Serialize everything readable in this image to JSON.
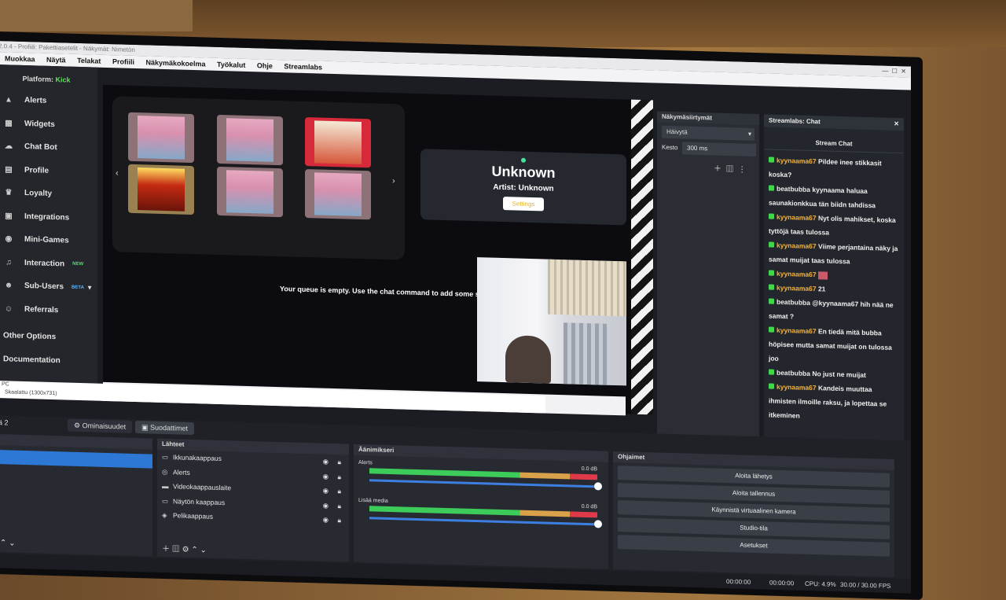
{
  "window": {
    "title": "2.0.4 - Profiili: Pakettiasetelit - Näkymät: Nimetön"
  },
  "menu": [
    "Muokkaa",
    "Näytä",
    "Telakat",
    "Profiili",
    "Näkymäkokoelma",
    "Työkalut",
    "Ohje",
    "Streamlabs"
  ],
  "sidebar": {
    "platform_label": "Platform:",
    "platform_value": "Kick",
    "items": [
      {
        "label": "Alerts",
        "icon": "alert-icon"
      },
      {
        "label": "Widgets",
        "icon": "widgets-icon"
      },
      {
        "label": "Chat Bot",
        "icon": "cloud-icon"
      },
      {
        "label": "Profile",
        "icon": "profile-icon"
      },
      {
        "label": "Loyalty",
        "icon": "trophy-icon"
      },
      {
        "label": "Integrations",
        "icon": "integrations-icon"
      },
      {
        "label": "Mini-Games",
        "icon": "gamepad-icon"
      },
      {
        "label": "Interaction",
        "icon": "music-icon",
        "badge": "NEW"
      },
      {
        "label": "Sub-Users",
        "icon": "users-icon",
        "badge": "BETA"
      },
      {
        "label": "Referrals",
        "icon": "referrals-icon"
      }
    ],
    "other_options": "Other Options",
    "documentation": "Documentation"
  },
  "preview": {
    "song_title": "Unknown",
    "artist_label": "Artist:",
    "artist_value": "Unknown",
    "settings_button": "Settings",
    "queue_message": "Your queue is empty. Use the chat command to add some song",
    "status_left": "PC",
    "scale_label": "Skaalattu (1300x731)"
  },
  "scene_transitions": {
    "title": "Näkymäsiirtymät",
    "transition": "Häivytä",
    "duration_label": "Kesto",
    "duration_value": "300 ms"
  },
  "chat": {
    "title": "Streamlabs: Chat",
    "subtitle": "Stream Chat",
    "messages": [
      {
        "user": "kyynaama67",
        "text": "Pildee inee stikkasit koska?"
      },
      {
        "user": "beatbubba",
        "text": "kyynaama haluaa saunakionkkua tän biidn tahdissa"
      },
      {
        "user": "kyynaama67",
        "text": "Nyt olis mahikset, koska tyttöjä taas tulossa"
      },
      {
        "user": "kyynaama67",
        "text": "Viime perjantaina näky ja samat muijat taas tulossa"
      },
      {
        "user": "kyynaama67",
        "text": ""
      },
      {
        "user": "kyynaama67",
        "text": "21"
      },
      {
        "user": "beatbubba",
        "text": "@kyynaama67 hih nää ne samat ?"
      },
      {
        "user": "kyynaama67",
        "text": "En tiedä mitä bubba höpisee mutta samat muijat on tulossa joo"
      },
      {
        "user": "beatbubba",
        "text": "No just ne muijat"
      },
      {
        "user": "kyynaama67",
        "text": "Kandeis muuttaa ihmisten ilmoille raksu, ja lopettaa se itkeminen"
      }
    ]
  },
  "bottom": {
    "scene_label": "ä 2",
    "tab_properties": "Ominaisuudet",
    "tab_filters": "Suodattimet",
    "sources_title": "Lähteet",
    "sources": [
      {
        "label": "Ikkunakaappaus",
        "icon": "window-icon"
      },
      {
        "label": "Alerts",
        "icon": "browser-icon"
      },
      {
        "label": "Videokaappauslaite",
        "icon": "camera-icon"
      },
      {
        "label": "Näytön kaappaus",
        "icon": "monitor-icon"
      },
      {
        "label": "Pelikaappaus",
        "icon": "gamepad-icon"
      }
    ],
    "mixer_title": "Äänimikseri",
    "mixer": [
      {
        "label": "Alerts",
        "db": "0.0 dB"
      },
      {
        "label": "Lisää media",
        "db": "0.0 dB"
      }
    ],
    "controls_title": "Ohjaimet",
    "controls": [
      "Aloita lähetys",
      "Aloita tallennus",
      "Käynnistä virtuaalinen kamera",
      "Studio-tila",
      "Asetukset"
    ],
    "status": {
      "time1": "00:00:00",
      "time2": "00:00:00",
      "cpu": "CPU: 4.9%",
      "fps": "30.00 / 30.00 FPS"
    }
  }
}
